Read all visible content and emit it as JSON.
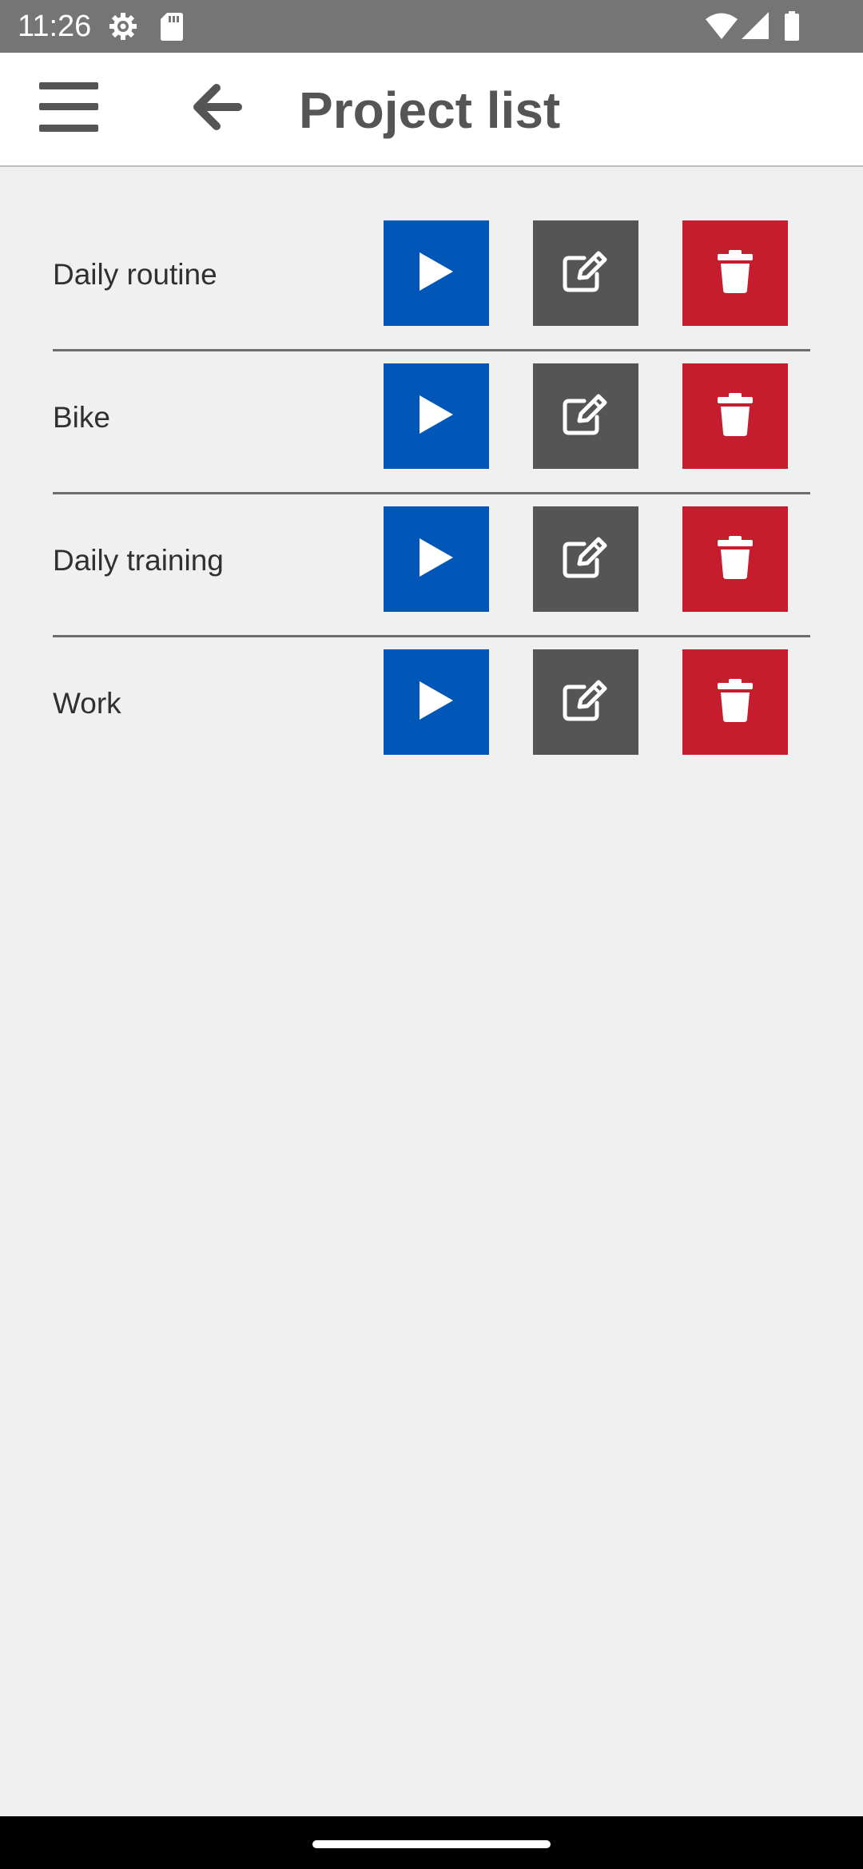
{
  "status_bar": {
    "time": "11:26",
    "icons": [
      "settings-gear-icon",
      "sd-card-icon",
      "wifi-icon",
      "cellular-signal-icon",
      "battery-icon"
    ]
  },
  "app_bar": {
    "title": "Project list",
    "menu_icon": "hamburger-menu-icon",
    "back_icon": "arrow-left-icon"
  },
  "projects": [
    {
      "name": "Daily routine"
    },
    {
      "name": "Bike"
    },
    {
      "name": "Daily training"
    },
    {
      "name": "Work"
    }
  ],
  "actions": {
    "start_icon": "play-icon",
    "edit_icon": "edit-icon",
    "delete_icon": "trash-icon"
  },
  "colors": {
    "status_bar": "#757575",
    "app_bar": "#ffffff",
    "background": "#f0f0f0",
    "start_button": "#0057b8",
    "edit_button": "#555555",
    "delete_button": "#c51d2e",
    "title_text": "#555555",
    "divider": "#6b6b6b"
  }
}
